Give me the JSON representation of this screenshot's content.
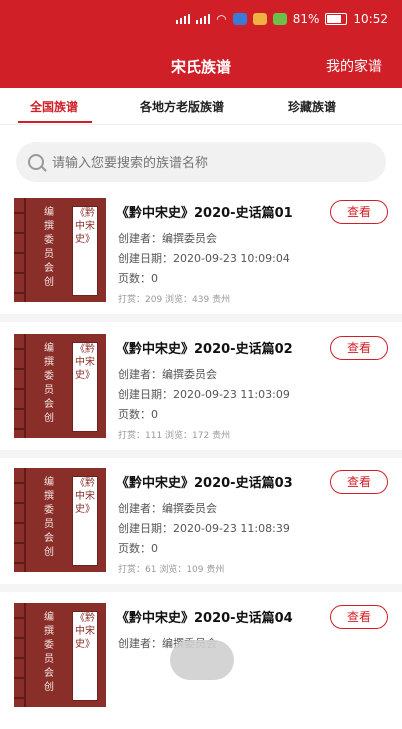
{
  "status": {
    "time": "10:52",
    "battery": "81%"
  },
  "header": {
    "title": "宋氏族谱",
    "right_link": "我的家谱"
  },
  "tabs": [
    {
      "label": "全国族谱",
      "active": true
    },
    {
      "label": "各地方老版族谱",
      "active": false
    },
    {
      "label": "珍藏族谱",
      "active": false
    }
  ],
  "search": {
    "placeholder": "请输入您要搜索的族谱名称"
  },
  "cover": {
    "editor_text": "编撰委员会创",
    "book_text": "《黔中宋史》"
  },
  "cards": [
    {
      "title": "《黔中宋史》2020-史话篇01",
      "creator": "创建者：编撰委员会",
      "date": "创建日期：2020-09-23 10:09:04",
      "pages": "页数：0",
      "stats": "打赏：209    浏览：439    贵州",
      "button": "查看"
    },
    {
      "title": "《黔中宋史》2020-史话篇02",
      "creator": "创建者：编撰委员会",
      "date": "创建日期：2020-09-23 11:03:09",
      "pages": "页数：0",
      "stats": "打赏：111    浏览：172    贵州",
      "button": "查看"
    },
    {
      "title": "《黔中宋史》2020-史话篇03",
      "creator": "创建者：编撰委员会",
      "date": "创建日期：2020-09-23 11:08:39",
      "pages": "页数：0",
      "stats": "打赏：61    浏览：109    贵州",
      "button": "查看"
    },
    {
      "title": "《黔中宋史》2020-史话篇04",
      "creator": "创建者：编撰委员会",
      "date": "",
      "pages": "",
      "stats": "",
      "button": "查看"
    }
  ],
  "colors": {
    "brand": "#d01f27",
    "cover": "#8a2e2a"
  }
}
